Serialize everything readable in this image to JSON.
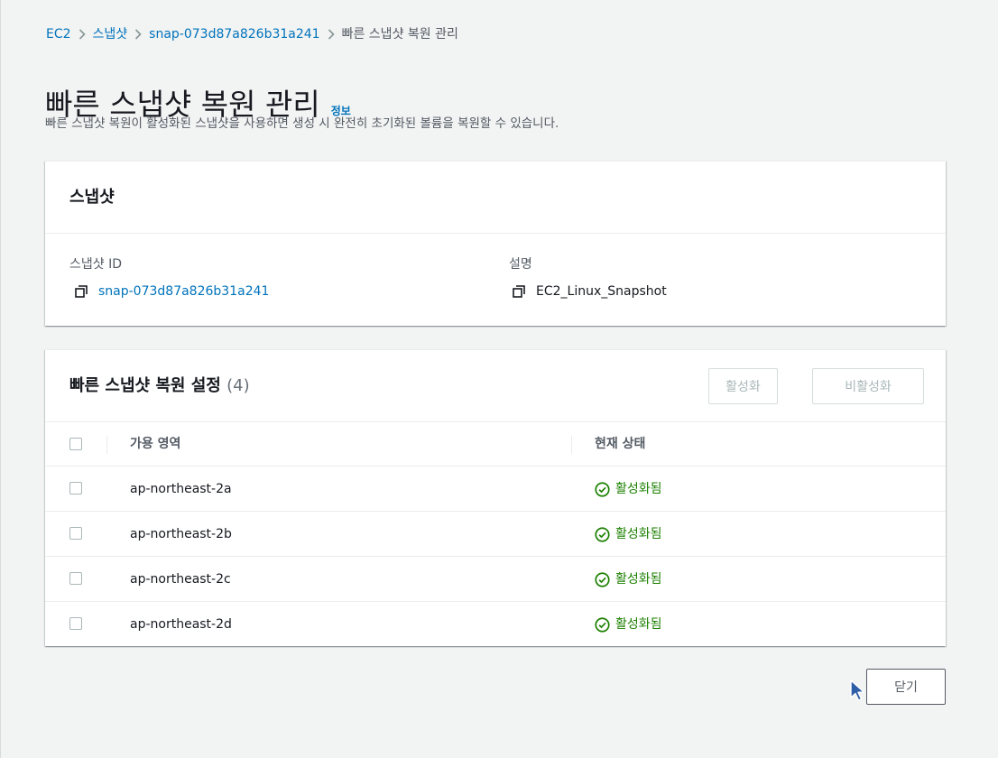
{
  "breadcrumb": {
    "items": [
      "EC2",
      "스냅샷",
      "snap-073d87a826b31a241"
    ],
    "current": "빠른 스냅샷 복원 관리"
  },
  "header": {
    "title": "빠른 스냅샷 복원 관리",
    "info_link": "정보",
    "description": "빠른 스냅샷 복원이 활성화된 스냅샷을 사용하면 생성 시 완전히 초기화된 볼륨을 복원할 수 있습니다."
  },
  "snapshot_panel": {
    "title": "스냅샷",
    "snapshot_id_label": "스냅샷 ID",
    "snapshot_id_value": "snap-073d87a826b31a241",
    "description_label": "설명",
    "description_value": "EC2_Linux_Snapshot"
  },
  "fsr_panel": {
    "title": "빠른 스냅샷 복원 설정",
    "count": "(4)",
    "activate_label": "활성화",
    "deactivate_label": "비활성화",
    "columns": [
      "가용 영역",
      "현재 상태"
    ],
    "rows": [
      {
        "zone": "ap-northeast-2a",
        "status": "활성화됨"
      },
      {
        "zone": "ap-northeast-2b",
        "status": "활성화됨"
      },
      {
        "zone": "ap-northeast-2c",
        "status": "활성화됨"
      },
      {
        "zone": "ap-northeast-2d",
        "status": "활성화됨"
      }
    ]
  },
  "footer": {
    "close_label": "닫기"
  },
  "colors": {
    "link": "#0073bb",
    "success": "#1d8102",
    "background": "#f2f3f3"
  },
  "icons": [
    "chevron-right-icon",
    "copy-icon",
    "check-circle-icon",
    "mouse-cursor-icon"
  ]
}
